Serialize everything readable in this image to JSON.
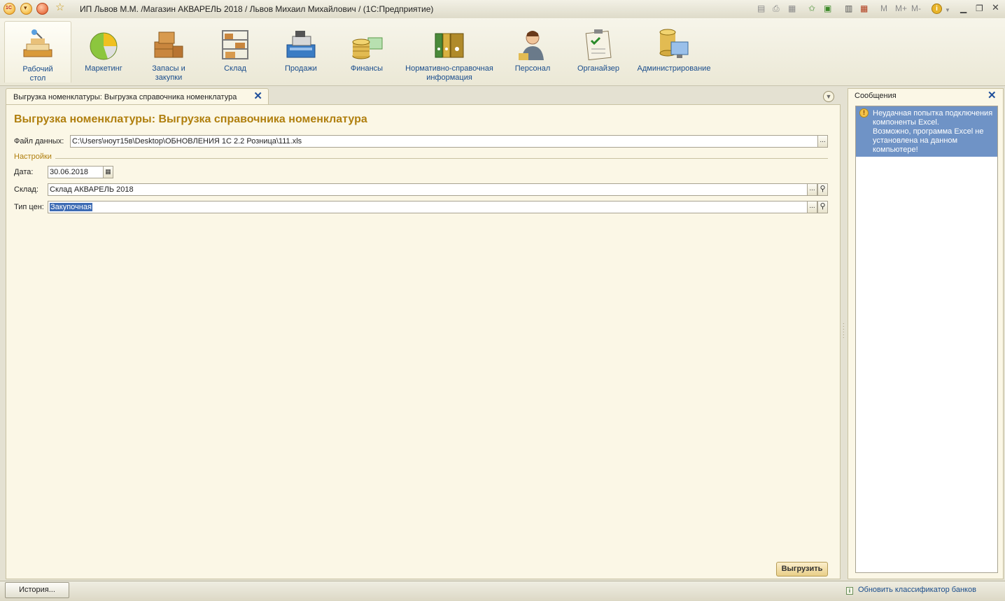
{
  "window": {
    "title": "ИП Львов М.М. /Магазин АКВАРЕЛЬ 2018 / Львов Михаил Михайлович /  (1С:Предприятие)",
    "toolbar_memory": [
      "M",
      "M+",
      "M-"
    ]
  },
  "sections": [
    {
      "label": "Рабочий\nстол",
      "icon": "desktop-icon",
      "active": true
    },
    {
      "label": "Маркетинг",
      "icon": "pie-chart-icon"
    },
    {
      "label": "Запасы и\nзакупки",
      "icon": "boxes-icon"
    },
    {
      "label": "Склад",
      "icon": "warehouse-rack-icon"
    },
    {
      "label": "Продажи",
      "icon": "cash-register-icon"
    },
    {
      "label": "Финансы",
      "icon": "coins-icon"
    },
    {
      "label": "Нормативно-справочная\nинформация",
      "icon": "binders-icon"
    },
    {
      "label": "Персонал",
      "icon": "person-icon"
    },
    {
      "label": "Органайзер",
      "icon": "checklist-icon"
    },
    {
      "label": "Администрирование",
      "icon": "database-computer-icon"
    }
  ],
  "form": {
    "tab_label": "Выгрузка номенклатуры: Выгрузка справочника номенклатура",
    "title": "Выгрузка номенклатуры: Выгрузка справочника номенклатура",
    "file_label": "Файл данных:",
    "file_value": "C:\\Users\\ноут15в\\Desktop\\ОБНОВЛЕНИЯ 1С 2.2 Розница\\111.xls",
    "group_label": "Настройки",
    "date_label": "Дата:",
    "date_value": "30.06.2018",
    "warehouse_label": "Склад:",
    "warehouse_value": "Склад АКВАРЕЛЬ 2018",
    "price_type_label": "Тип цен:",
    "price_type_value": "Закупочная",
    "upload_button": "Выгрузить",
    "choice_button": "..."
  },
  "messages": {
    "title": "Сообщения",
    "items": [
      "Неудачная попытка подключения компоненты Excel.\nВозможно, программа Excel не установлена на данном компьютере!"
    ]
  },
  "status": {
    "history_button": "История...",
    "link": "Обновить классификатор банков"
  },
  "colors": {
    "accent_title": "#b07f0e",
    "link": "#1a4d8c",
    "selection": "#3d6bb4",
    "message_highlight": "#6f93c6"
  }
}
